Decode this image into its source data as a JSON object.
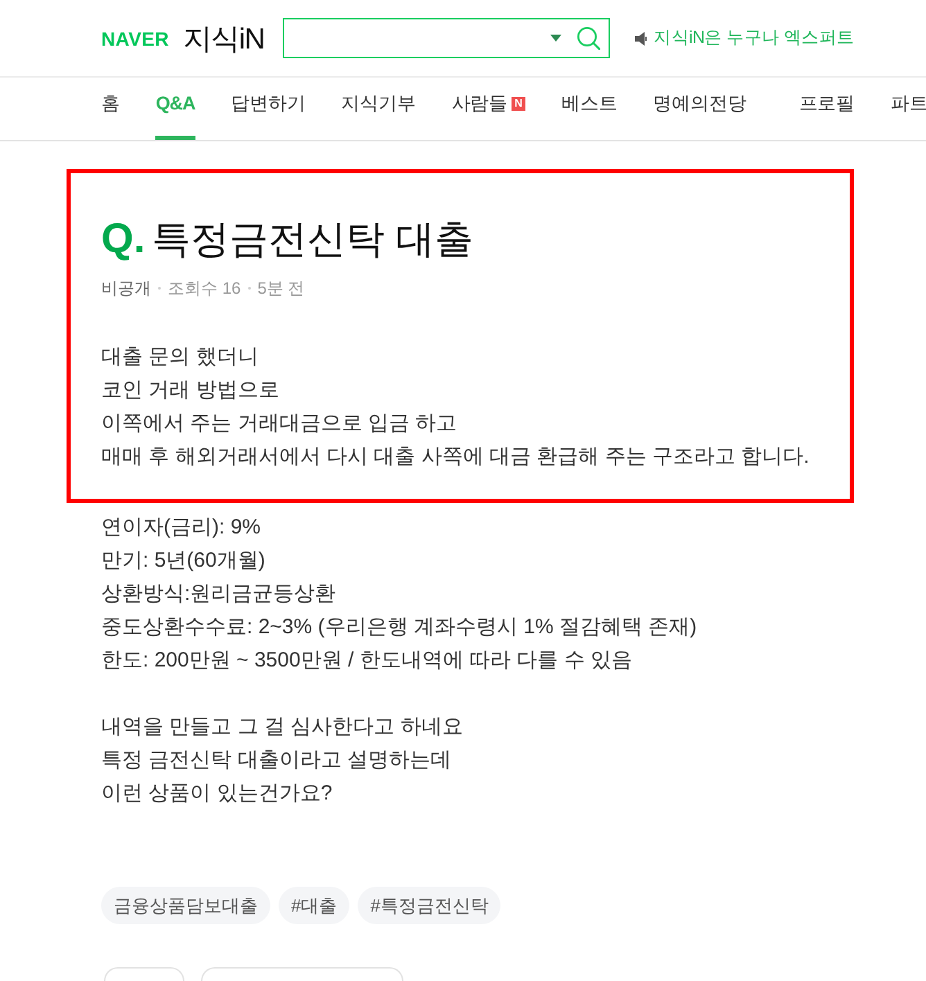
{
  "header": {
    "logo": "NAVER",
    "service_name": "지식iN",
    "notice": "지식iN은 누구나 엑스퍼트"
  },
  "nav": {
    "tab_groups": [
      {
        "tabs": [
          {
            "label": "홈",
            "selected": false
          },
          {
            "label": "Q&A",
            "selected": true
          },
          {
            "label": "답변하기",
            "selected": false
          },
          {
            "label": "지식기부",
            "selected": false
          },
          {
            "label": "사람들",
            "selected": false,
            "badge": "N"
          },
          {
            "label": "베스트",
            "selected": false
          },
          {
            "label": "명예의전당",
            "selected": false
          }
        ]
      },
      {
        "tabs": [
          {
            "label": "프로필",
            "selected": false
          },
          {
            "label": "파트",
            "selected": false
          }
        ]
      }
    ]
  },
  "question": {
    "highlighted": true,
    "mark": "Q.",
    "title": "특정금전신탁 대출",
    "meta": [
      {
        "kind": "author",
        "text": "비공개"
      },
      {
        "kind": "stat",
        "text": "조회수 16"
      },
      {
        "kind": "stat",
        "text": "5분 전"
      }
    ],
    "intro_lines": [
      "대출 문의 했더니",
      "코인 거래 방법으로",
      "이쪽에서 주는 거래대금으로 입금 하고",
      "매매 후 해외거래서에서 다시 대출 사쪽에 대금 환급해 주는 구조라고 합니다."
    ]
  },
  "body": {
    "paragraphs": [
      {
        "lines": [
          "연이자(금리): 9%",
          "만기: 5년(60개월)",
          "상환방식:원리금균등상환",
          "중도상환수수료: 2~3% (우리은행 계좌수령시 1% 절감혜택 존재)",
          "한도: 200만원 ~ 3500만원 / 한도내역에 따라 다를 수 있음"
        ]
      },
      {
        "lines": [
          "내역을 만들고 그 걸 심사한다고 하네요",
          "특정 금전신탁 대출이라고 설명하는데",
          "이런 상품이 있는건가요?"
        ]
      }
    ]
  },
  "tags": [
    "금융상품담보대출",
    "#대출",
    "#특정금전신탁"
  ]
}
